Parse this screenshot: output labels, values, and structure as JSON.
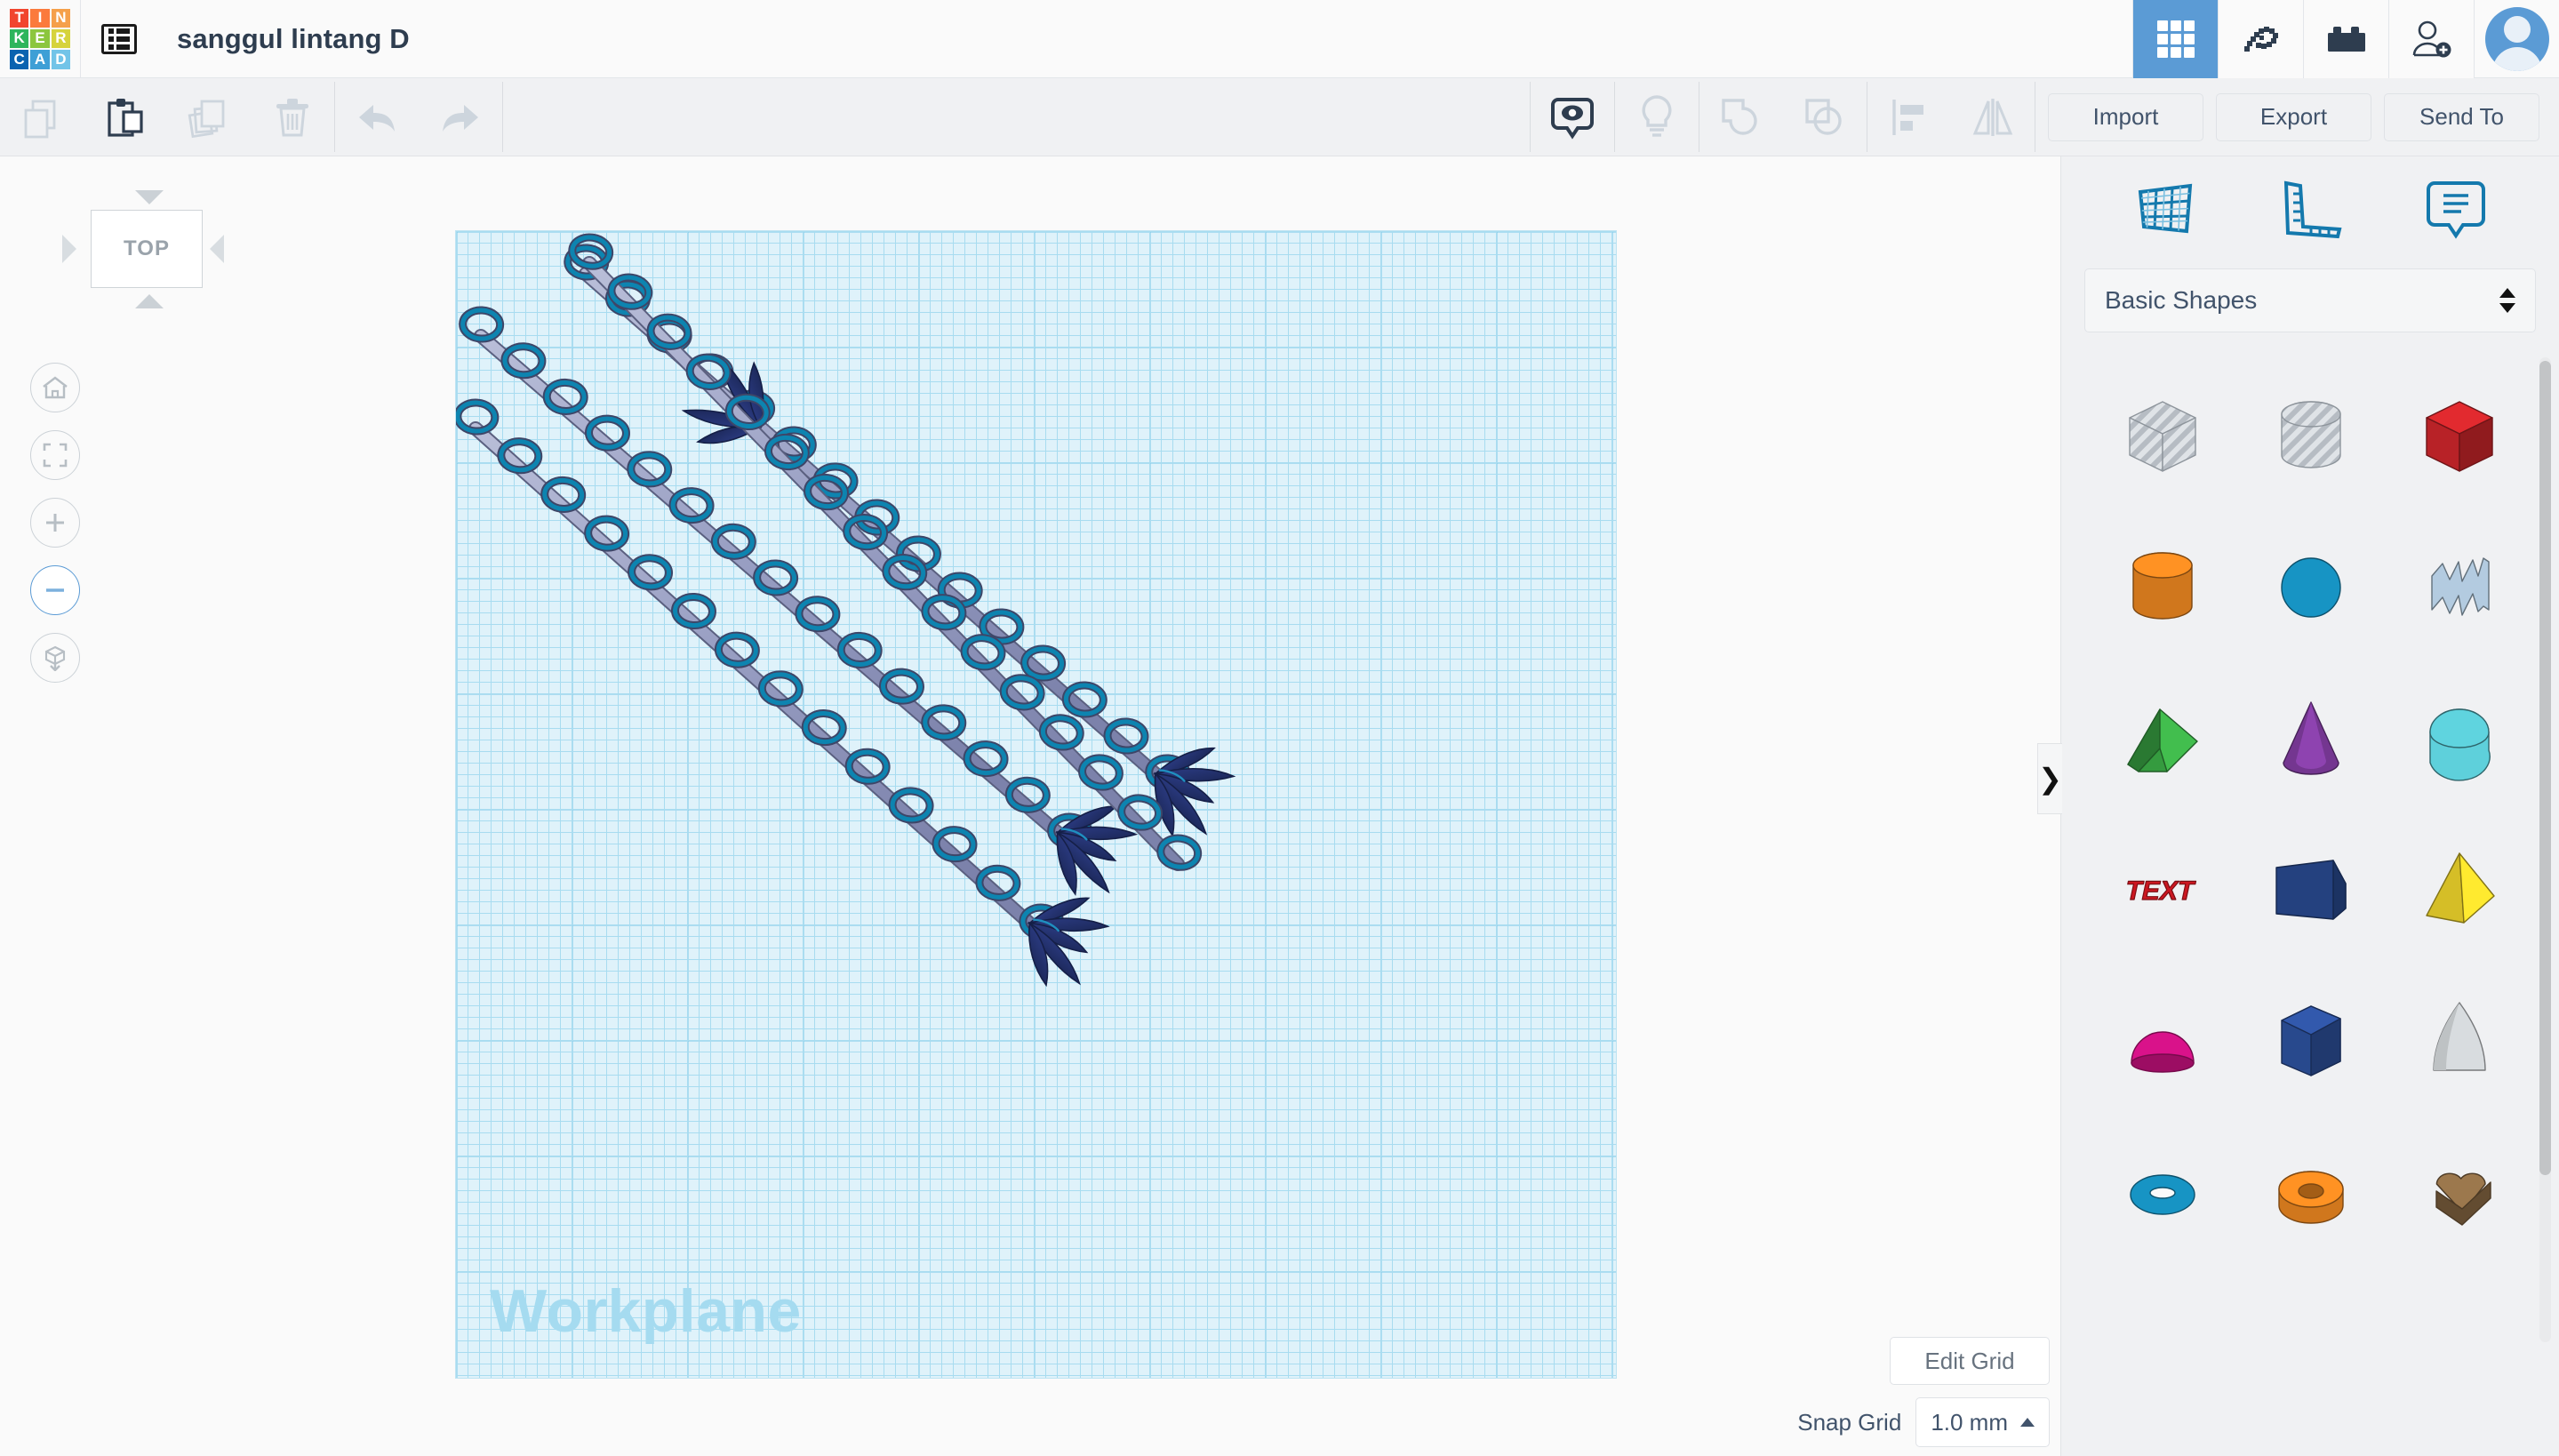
{
  "app": {
    "logo_letters": [
      {
        "ch": "T",
        "color": "#f1452e"
      },
      {
        "ch": "I",
        "color": "#fb7a3c"
      },
      {
        "ch": "N",
        "color": "#f5a04a"
      },
      {
        "ch": "K",
        "color": "#2eb55c"
      },
      {
        "ch": "E",
        "color": "#8cc63e"
      },
      {
        "ch": "R",
        "color": "#d6d33c"
      },
      {
        "ch": "C",
        "color": "#0b63b0"
      },
      {
        "ch": "A",
        "color": "#3e9fd6"
      },
      {
        "ch": "D",
        "color": "#72c4e8"
      }
    ],
    "gallery_icon": "list-icon",
    "project_title": "sanggul lintang D",
    "accent_blue": "#5b9bd5"
  },
  "topbar_right": [
    {
      "name": "designs-grid-icon",
      "label": "3D Designs",
      "active": true
    },
    {
      "name": "minecraft-pickaxe-icon",
      "label": "Minecraft",
      "active": false
    },
    {
      "name": "lego-brick-icon",
      "label": "Bricks",
      "active": false
    },
    {
      "name": "add-person-icon",
      "label": "Invite",
      "active": false
    }
  ],
  "toolbar": {
    "left_tools": [
      {
        "name": "copy-icon",
        "label": "Copy",
        "enabled": false
      },
      {
        "name": "paste-icon",
        "label": "Paste",
        "enabled": true
      },
      {
        "name": "duplicate-icon",
        "label": "Duplicate",
        "enabled": false
      },
      {
        "name": "delete-icon",
        "label": "Delete",
        "enabled": false
      }
    ],
    "history_tools": [
      {
        "name": "undo-icon",
        "label": "Undo",
        "enabled": false
      },
      {
        "name": "redo-icon",
        "label": "Redo",
        "enabled": false
      }
    ],
    "right_tools": [
      {
        "name": "show-hide-eye-icon",
        "label": "Show/Hide",
        "enabled": true
      },
      {
        "name": "light-bulb-icon",
        "label": "Note",
        "enabled": false
      },
      {
        "name": "group-icon",
        "label": "Group",
        "enabled": false
      },
      {
        "name": "ungroup-icon",
        "label": "Ungroup",
        "enabled": false
      },
      {
        "name": "align-icon",
        "label": "Align",
        "enabled": false
      },
      {
        "name": "mirror-icon",
        "label": "Mirror",
        "enabled": false
      }
    ],
    "actions": [
      {
        "name": "import-button",
        "label": "Import"
      },
      {
        "name": "export-button",
        "label": "Export"
      },
      {
        "name": "send-to-button",
        "label": "Send To"
      }
    ]
  },
  "canvas": {
    "view_cube_label": "TOP",
    "workplane_label": "Workplane",
    "grid_minor_color": "#a8dcf0",
    "grid_major_color": "#7bc8e8",
    "grid_bg_color": "#dff2fa",
    "nav_buttons": [
      {
        "name": "home-view-button",
        "label": "Home view",
        "selected": false
      },
      {
        "name": "fit-to-view-button",
        "label": "Fit all in view",
        "selected": false
      },
      {
        "name": "zoom-in-button",
        "label": "Zoom in",
        "selected": false
      },
      {
        "name": "zoom-out-button",
        "label": "Zoom out",
        "selected": true
      },
      {
        "name": "perspective-toggle-button",
        "label": "Switch to orthographic view",
        "selected": false
      }
    ],
    "model": {
      "description": "Four diagonal hairpin rods with ring loops and navy leaf clusters",
      "rod_color": "#9aa0c4",
      "ring_color": "#0d84b0",
      "leaf_color": "#23316f"
    }
  },
  "right_panel": {
    "view_icons": [
      {
        "name": "workplane-icon",
        "label": "Workplane"
      },
      {
        "name": "ruler-icon",
        "label": "Ruler"
      },
      {
        "name": "note-icon",
        "label": "Note"
      }
    ],
    "shape_library": {
      "selected": "Basic Shapes",
      "name": "shape-library-select"
    },
    "shapes": [
      {
        "name": "box-hole",
        "label": "Box Hole",
        "color": "#c6cbd1",
        "kind": "box",
        "hole": true
      },
      {
        "name": "cylinder-hole",
        "label": "Cylinder Hole",
        "color": "#c6cbd1",
        "kind": "cylinder",
        "hole": true
      },
      {
        "name": "box",
        "label": "Box",
        "color": "#c8252a",
        "kind": "box",
        "hole": false
      },
      {
        "name": "cylinder",
        "label": "Cylinder",
        "color": "#e2811f",
        "kind": "cylinder",
        "hole": false
      },
      {
        "name": "sphere",
        "label": "Sphere",
        "color": "#1794c4",
        "kind": "sphere",
        "hole": false
      },
      {
        "name": "scribble",
        "label": "Scribble",
        "color": "#b3cbe0",
        "kind": "scribble",
        "hole": false
      },
      {
        "name": "roof",
        "label": "Roof",
        "color": "#3aa845",
        "kind": "roof",
        "hole": false
      },
      {
        "name": "cone",
        "label": "Cone",
        "color": "#7e3b9c",
        "kind": "cone",
        "hole": false
      },
      {
        "name": "half-tube",
        "label": "Tube",
        "color": "#53b8c2",
        "kind": "halftube",
        "hole": false
      },
      {
        "name": "text",
        "label": "Text",
        "color": "#cc1721",
        "kind": "text",
        "hole": false
      },
      {
        "name": "wedge",
        "label": "Wedge",
        "color": "#27478a",
        "kind": "wedge",
        "hole": false
      },
      {
        "name": "pyramid",
        "label": "Pyramid",
        "color": "#e8cf2a",
        "kind": "pyramid",
        "hole": false
      },
      {
        "name": "half-sphere",
        "label": "Half Sphere",
        "color": "#d9128a",
        "kind": "halfsphere",
        "hole": false
      },
      {
        "name": "polygon-prism",
        "label": "Polygon",
        "color": "#2c4f99",
        "kind": "hexprism",
        "hole": false
      },
      {
        "name": "paraboloid",
        "label": "Paraboloid",
        "color": "#d8dcdf",
        "kind": "paraboloid",
        "hole": false
      },
      {
        "name": "torus",
        "label": "Torus",
        "color": "#1794c4",
        "kind": "torus",
        "hole": false
      },
      {
        "name": "tube",
        "label": "Tube",
        "color": "#e2811f",
        "kind": "ring",
        "hole": false
      },
      {
        "name": "heart",
        "label": "Heart",
        "color": "#8a6a44",
        "kind": "heart",
        "hole": false
      }
    ],
    "collapse_handle": "❯"
  },
  "grid_controls": {
    "edit_grid_label": "Edit Grid",
    "snap_grid_label": "Snap Grid",
    "snap_grid_value": "1.0 mm"
  }
}
